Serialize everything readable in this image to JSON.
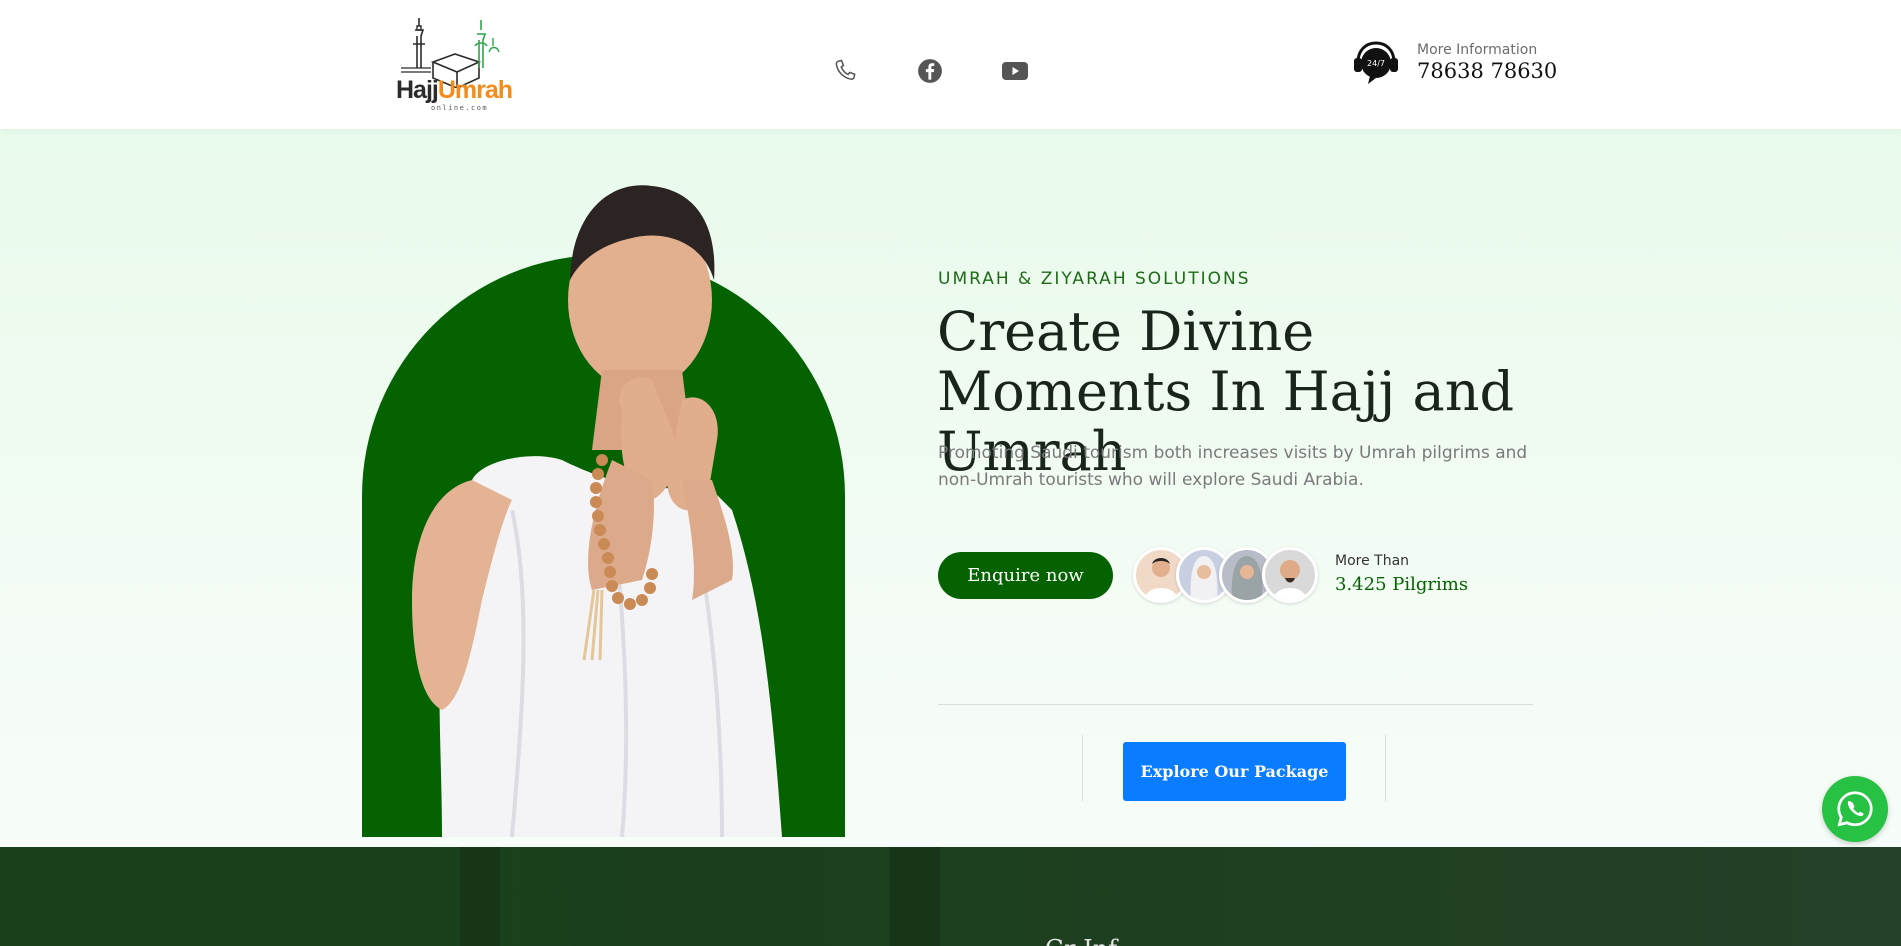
{
  "brand": {
    "logo_word_1": "Hajj",
    "logo_word_2": "Umrah",
    "logo_sub": "online.com",
    "logo_mark": "®",
    "colors": {
      "dark": "#2b2b2b",
      "orange": "#f28c1c",
      "green": "#2fa64a"
    }
  },
  "header": {
    "social": [
      {
        "name": "phone",
        "icon": "phone-icon"
      },
      {
        "name": "facebook",
        "icon": "facebook-icon"
      },
      {
        "name": "youtube",
        "icon": "youtube-icon"
      }
    ],
    "info_badge": "24/7",
    "info_label": "More Information",
    "info_phone": "78638 78630"
  },
  "hero": {
    "eyebrow": "UMRAH & ZIYARAH SOLUTIONS",
    "headline": "Create Divine Moments In Hajj and Umrah",
    "lede": "Promoting Saudi tourism both increases visits by Umrah pilgrims and non-Umrah tourists who will explore Saudi Arabia.",
    "enquire_label": "Enquire now",
    "pilgrims_label": "More Than",
    "pilgrims_value": "3.425 Pilgrims",
    "avatar_count": 4,
    "explore_label": "Explore Our Package"
  },
  "band": {
    "title_partial": "Gr   Inf"
  },
  "colors": {
    "primary_green": "#046200",
    "hero_bg": "#e8faeb",
    "explore_blue": "#0a7cff",
    "band_green": "#1c3f1d",
    "whatsapp_green": "#27c244"
  },
  "floating": {
    "whatsapp_icon": "whatsapp-icon"
  }
}
